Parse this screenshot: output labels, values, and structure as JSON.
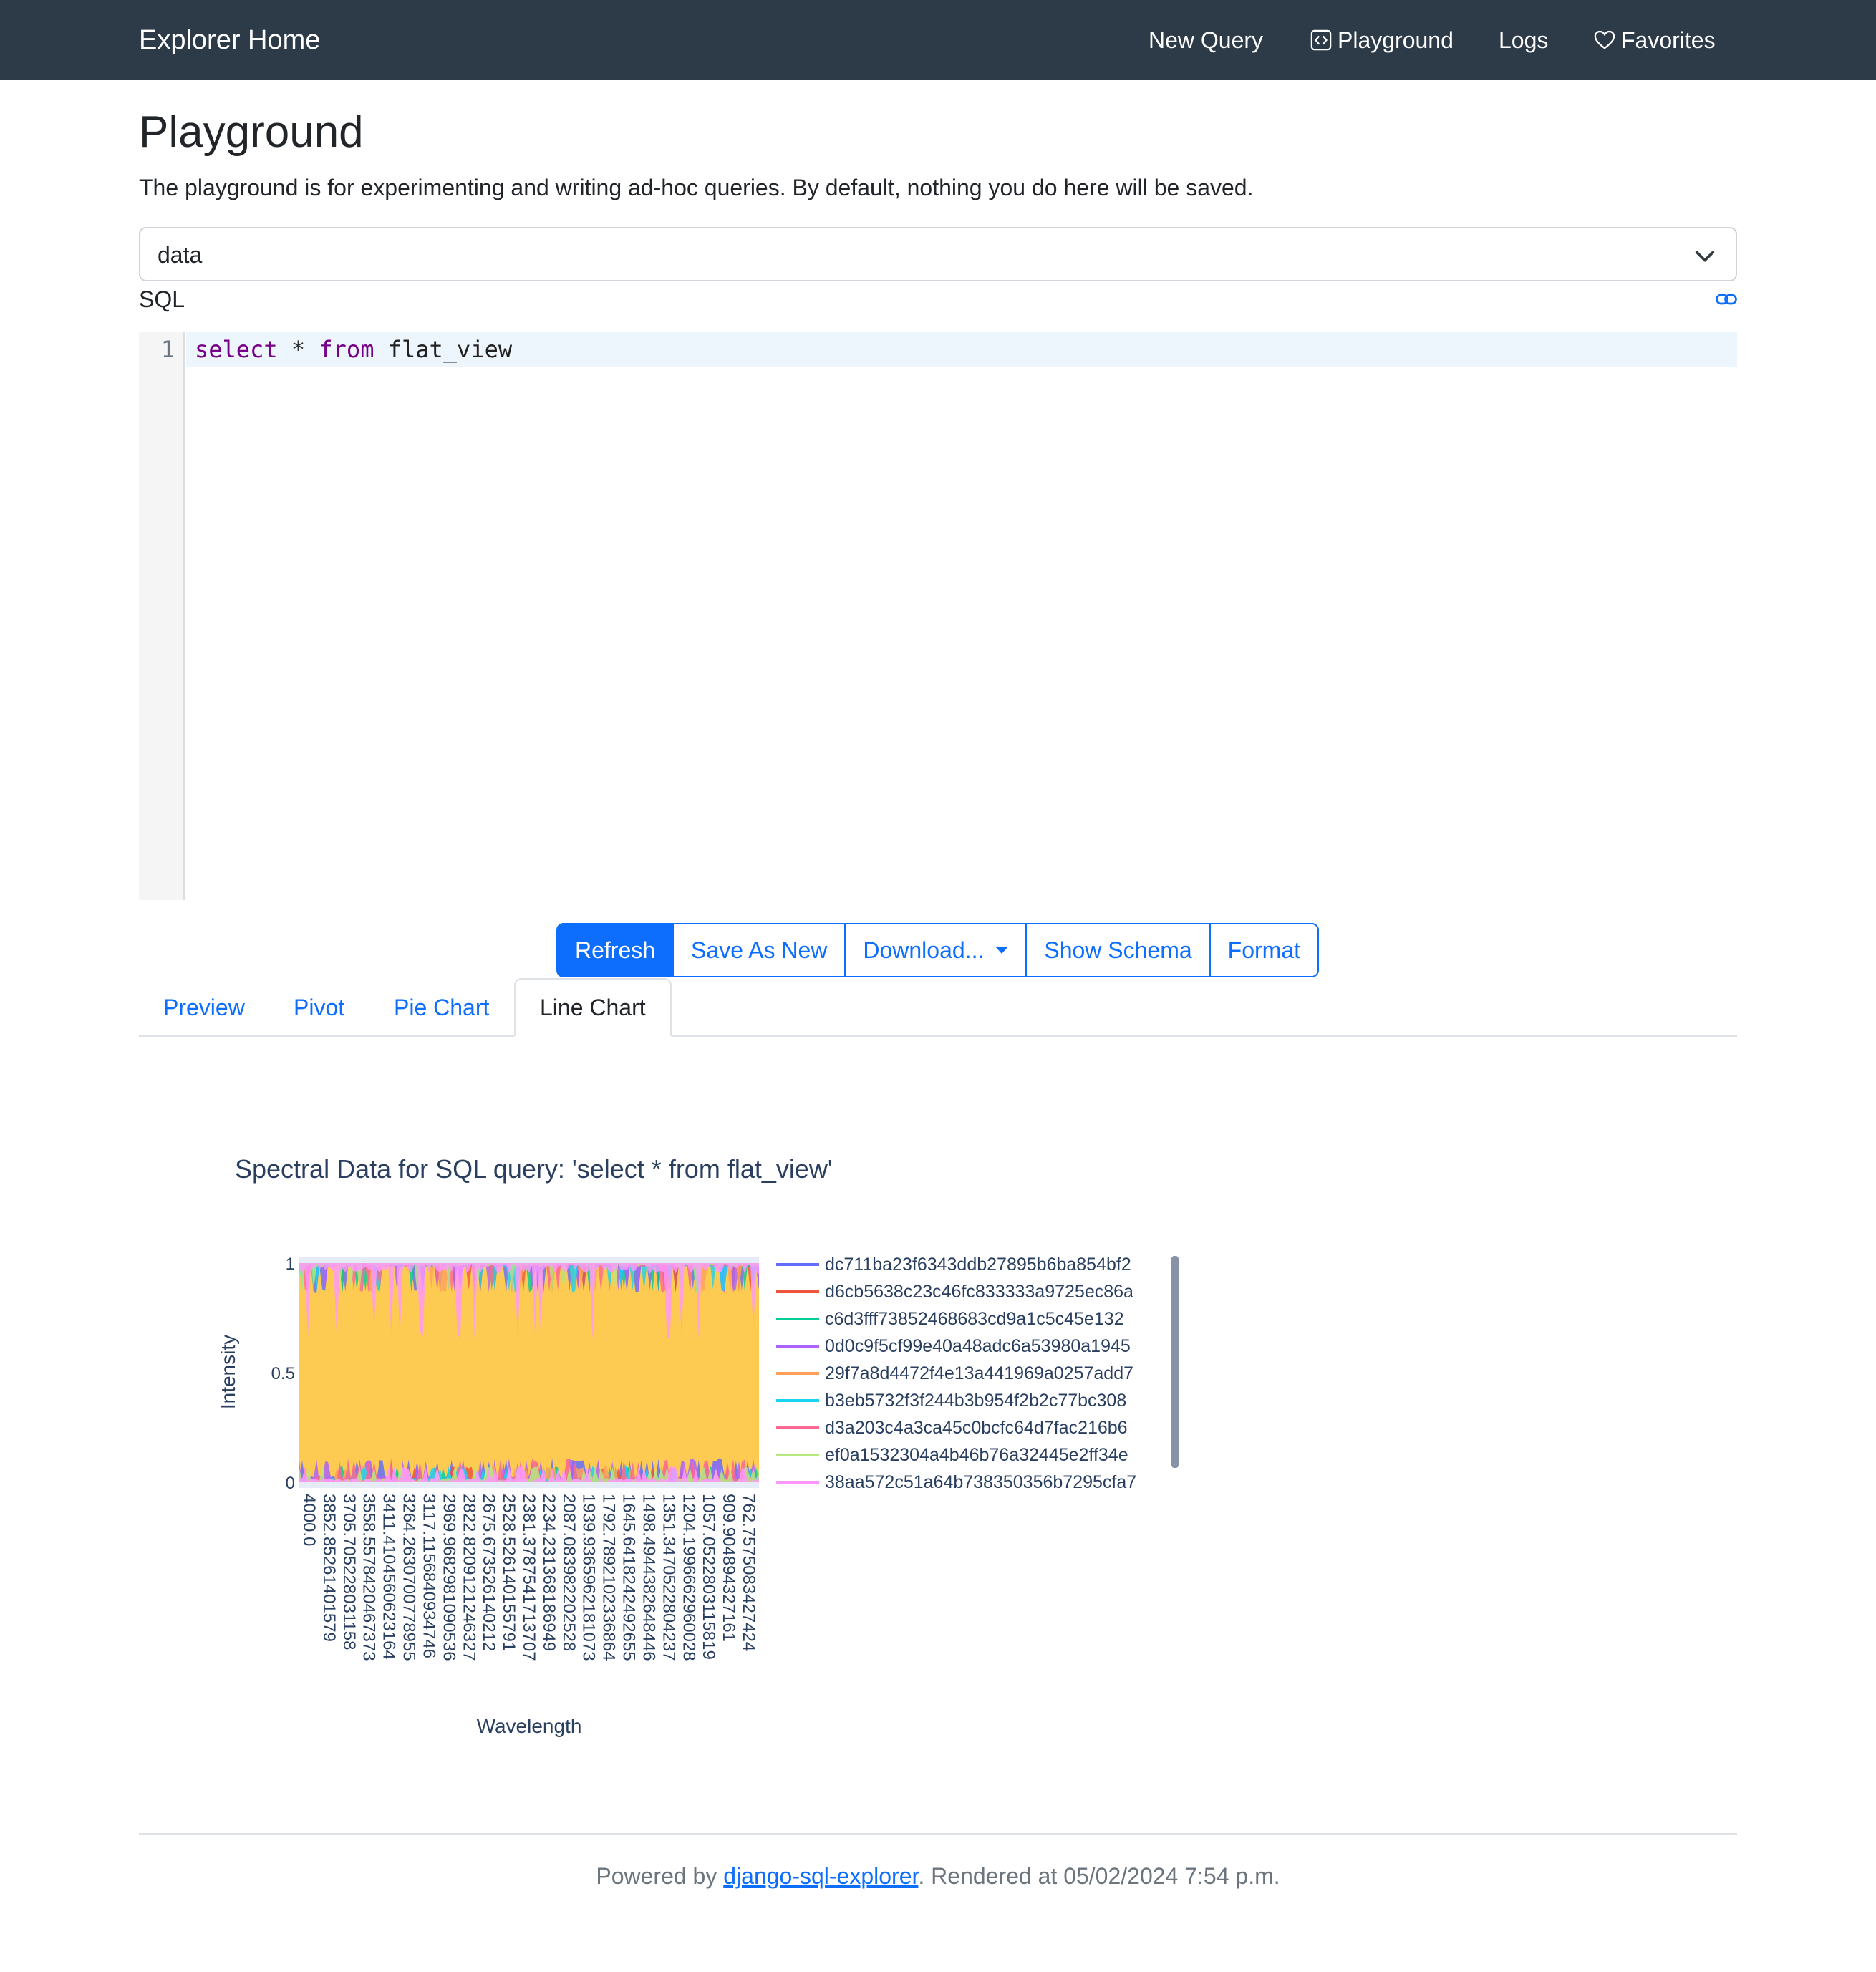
{
  "navbar": {
    "brand": "Explorer Home",
    "links": [
      {
        "label": "New Query"
      },
      {
        "label": "Playground",
        "icon": "code-square-icon"
      },
      {
        "label": "Logs"
      },
      {
        "label": "Favorites",
        "icon": "heart-icon"
      }
    ]
  },
  "page": {
    "title": "Playground",
    "description": "The playground is for experimenting and writing ad-hoc queries. By default, nothing you do here will be saved."
  },
  "connection_select": {
    "value": "data"
  },
  "sql": {
    "label": "SQL",
    "line_number": "1",
    "keyword_select": "select",
    "star": "*",
    "keyword_from": "from",
    "table": "flat_view"
  },
  "buttons": {
    "refresh": "Refresh",
    "save_as_new": "Save As New",
    "download": "Download...",
    "show_schema": "Show Schema",
    "format": "Format"
  },
  "tabs": [
    "Preview",
    "Pivot",
    "Pie Chart",
    "Line Chart"
  ],
  "active_tab": "Line Chart",
  "chart_data": {
    "type": "area",
    "title": "Spectral Data for SQL query: 'select * from flat_view'",
    "xlabel": "Wavelength",
    "ylabel": "Intensity",
    "ylim": [
      0,
      1
    ],
    "y_ticks": [
      "0",
      "0.5",
      "1"
    ],
    "x_ticks": [
      "4000.0",
      "3852.8526140157 9",
      "3705.705228031158",
      "3558.557842046737 3",
      "3411.410456062316 4",
      "3264.263070077895 5",
      "3117.115684093474 6",
      "2969.968298109053 6",
      "2822.820912124632 7",
      "2675.673526140212",
      "2528.526140155791",
      "2381.378754171370 7",
      "2234.231368186949",
      "2087.083982202528",
      "1939.936596218107 3",
      "1792.789210233686 4",
      "1645.641824249265 5",
      "1498.494438264844 6",
      "1351.347052280423 7",
      "1204.199666296002 8",
      "1057.052280311581 9",
      "909.904894327161",
      "762.757508342742 4"
    ],
    "legend_placement": "right",
    "series": [
      {
        "name": "dc711ba23f6343ddb27895b6ba854bf2",
        "color": "#636efa"
      },
      {
        "name": "d6cb5638c23c46fc833333a9725ec86a",
        "color": "#ef553b"
      },
      {
        "name": "c6d3fff73852468683cd9a1c5c45e132",
        "color": "#00cc96"
      },
      {
        "name": "0d0c9f5cf99e40a48adc6a53980a1945",
        "color": "#ab63fa"
      },
      {
        "name": "29f7a8d4472f4e13a441969a0257add7",
        "color": "#ffa15a"
      },
      {
        "name": "b3eb5732f3f244b3b954f2b2c77bc308",
        "color": "#19d3f3"
      },
      {
        "name": "d3a203c4a3ca45c0bcfc64d7fac216b6",
        "color": "#ff6692"
      },
      {
        "name": "ef0a1532304a4b46b76a32445e2ff34e",
        "color": "#b6e880"
      },
      {
        "name": "38aa572c51a64b738350356b7295cfa7",
        "color": "#ff97ff"
      }
    ],
    "dominant_fill": "#fecb52"
  },
  "footer": {
    "prefix": "Powered by ",
    "link": "django-sql-explorer",
    "suffix": ". Rendered at 05/02/2024 7:54 p.m."
  }
}
